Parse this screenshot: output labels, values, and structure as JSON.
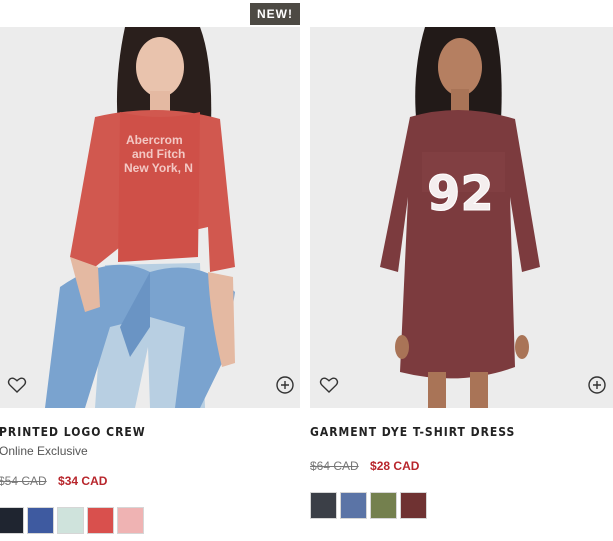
{
  "products": [
    {
      "badge": "NEW!",
      "title": "PRINTED LOGO CREW",
      "subtitle": "Online Exclusive",
      "old_price": "$54 CAD",
      "sale_price": "$34 CAD",
      "shirt_text": [
        "Abercrom",
        "and Fitch",
        "New York, N"
      ],
      "swatch_colors": [
        "#1f2530",
        "#3e5aa0",
        "#cfe3dc",
        "#d9504d",
        "#efb3b3"
      ]
    },
    {
      "title": "GARMENT DYE T-SHIRT DRESS",
      "old_price": "$64 CAD",
      "sale_price": "$28 CAD",
      "shirt_text": [
        "92"
      ],
      "swatch_colors": [
        "#3b3f47",
        "#5b74a6",
        "#74804e",
        "#6f3232"
      ]
    }
  ],
  "icons": {
    "wishlist": "heart-outline-icon",
    "quick_add": "plus-circle-icon"
  },
  "colors": {
    "sale_price": "#b8262c",
    "badge_bg": "#4d4a44"
  }
}
